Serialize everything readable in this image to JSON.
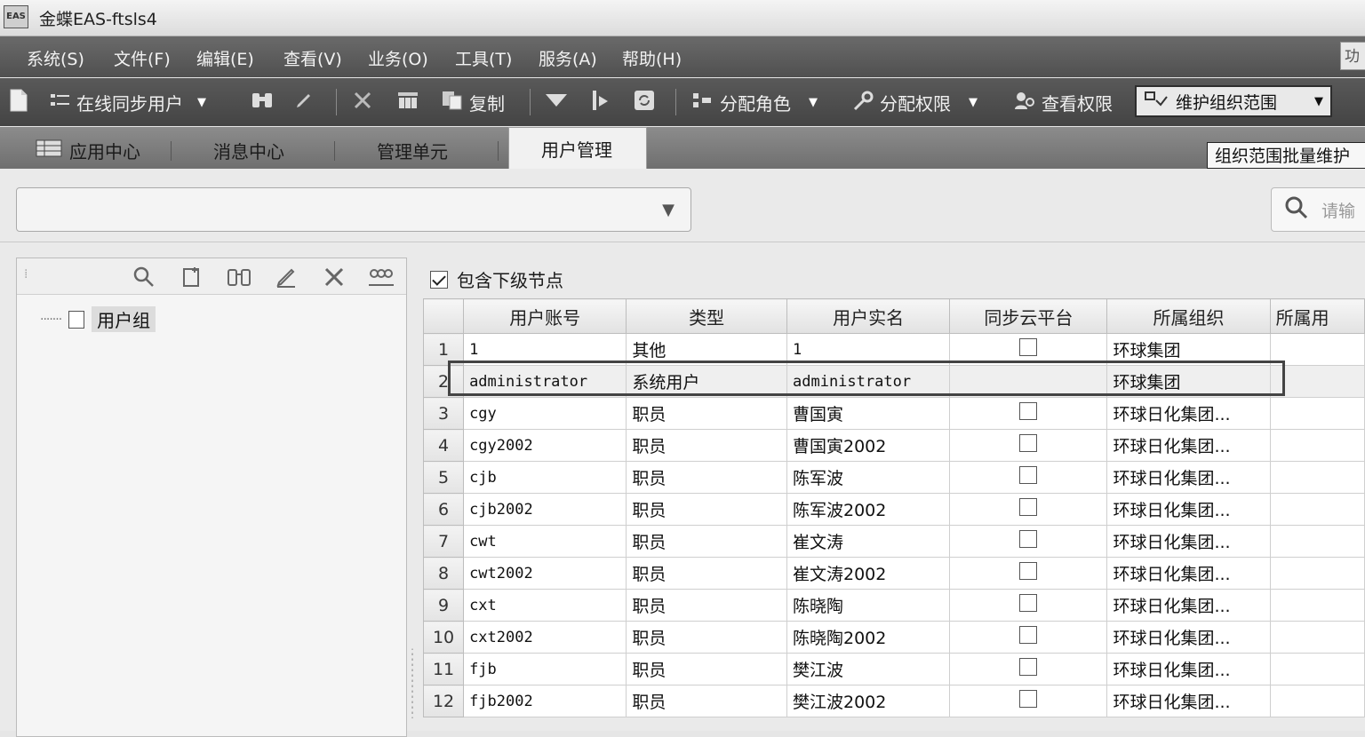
{
  "window": {
    "icon_text": "EAS",
    "title": "金蝶EAS-ftsls4"
  },
  "menu": {
    "items": [
      "系统(S)",
      "文件(F)",
      "编辑(E)",
      "查看(V)",
      "业务(O)",
      "工具(T)",
      "服务(A)",
      "帮助(H)"
    ],
    "right_box": "功"
  },
  "toolbar": {
    "sync_users": "在线同步用户",
    "copy": "复制",
    "assign_role": "分配角色",
    "assign_permission": "分配权限",
    "view_permission": "查看权限",
    "maintain_org_scope": "维护组织范围"
  },
  "tabs": [
    "应用中心",
    "消息中心",
    "管理单元",
    "用户管理"
  ],
  "tooltip": "组织范围批量维护",
  "search": {
    "placeholder": "请输"
  },
  "tree": {
    "root_label": "用户组"
  },
  "include_sub_nodes": {
    "label": "包含下级节点",
    "checked": true
  },
  "grid": {
    "columns": [
      "用户账号",
      "类型",
      "用户实名",
      "同步云平台",
      "所属组织",
      "所属用"
    ],
    "rows": [
      {
        "no": "1",
        "account": "1",
        "type": "其他",
        "name": "1",
        "sync": true,
        "org": "环球集团"
      },
      {
        "no": "2",
        "account": "administrator",
        "type": "系统用户",
        "name": "administrator",
        "sync": false,
        "org": "环球集团"
      },
      {
        "no": "3",
        "account": "cgy",
        "type": "职员",
        "name": "曹国寅",
        "sync": true,
        "org": "环球日化集团..."
      },
      {
        "no": "4",
        "account": "cgy2002",
        "type": "职员",
        "name": "曹国寅2002",
        "sync": true,
        "org": "环球日化集团..."
      },
      {
        "no": "5",
        "account": "cjb",
        "type": "职员",
        "name": "陈军波",
        "sync": true,
        "org": "环球日化集团..."
      },
      {
        "no": "6",
        "account": "cjb2002",
        "type": "职员",
        "name": "陈军波2002",
        "sync": true,
        "org": "环球日化集团..."
      },
      {
        "no": "7",
        "account": "cwt",
        "type": "职员",
        "name": "崔文涛",
        "sync": true,
        "org": "环球日化集团..."
      },
      {
        "no": "8",
        "account": "cwt2002",
        "type": "职员",
        "name": "崔文涛2002",
        "sync": true,
        "org": "环球日化集团..."
      },
      {
        "no": "9",
        "account": "cxt",
        "type": "职员",
        "name": "陈晓陶",
        "sync": true,
        "org": "环球日化集团..."
      },
      {
        "no": "10",
        "account": "cxt2002",
        "type": "职员",
        "name": "陈晓陶2002",
        "sync": true,
        "org": "环球日化集团..."
      },
      {
        "no": "11",
        "account": "fjb",
        "type": "职员",
        "name": "樊江波",
        "sync": true,
        "org": "环球日化集团..."
      },
      {
        "no": "12",
        "account": "fjb2002",
        "type": "职员",
        "name": "樊江波2002",
        "sync": true,
        "org": "环球日化集团..."
      }
    ],
    "selected_row": "2"
  }
}
